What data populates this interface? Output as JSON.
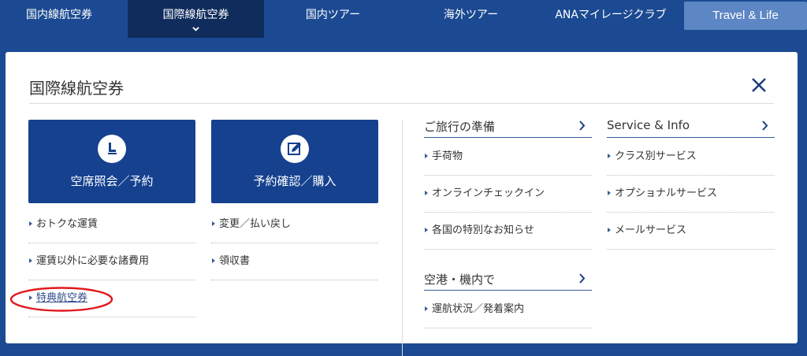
{
  "nav": {
    "items": [
      {
        "label": "国内線航空券"
      },
      {
        "label": "国際線航空券"
      },
      {
        "label": "国内ツアー"
      },
      {
        "label": "海外ツアー"
      },
      {
        "label": "ANAマイレージクラブ"
      },
      {
        "label": "Travel & Life"
      }
    ],
    "active_index": 1
  },
  "panel": {
    "title": "国際線航空券",
    "close_icon": "close-icon",
    "buttons": [
      {
        "label": "空席照会／予約",
        "icon": "seat-icon"
      },
      {
        "label": "予約確認／購入",
        "icon": "edit-icon"
      }
    ],
    "links_left": [
      "おトクな運賃",
      "運賃以外に必要な諸費用",
      "特典航空券"
    ],
    "links_middle": [
      "変更／払い戻し",
      "領収書"
    ],
    "sections": {
      "travel_prep": {
        "title": "ご旅行の準備",
        "links": [
          "手荷物",
          "オンラインチェックイン",
          "各国の特別なお知らせ"
        ]
      },
      "service_info": {
        "title": "Service & Info",
        "links": [
          "クラス別サービス",
          "オプショナルサービス",
          "メールサービス"
        ]
      },
      "airport": {
        "title": "空港・機内で",
        "links": [
          "運航状況／発着案内"
        ]
      }
    }
  },
  "annotation": {
    "highlight_color": "#e0181e",
    "highlighted_link": "特典航空券"
  },
  "colors": {
    "nav_bg": "#1b4a92",
    "nav_active": "#0f2c5c",
    "button_blue": "#15418f",
    "accent_line": "#3a5a99"
  }
}
